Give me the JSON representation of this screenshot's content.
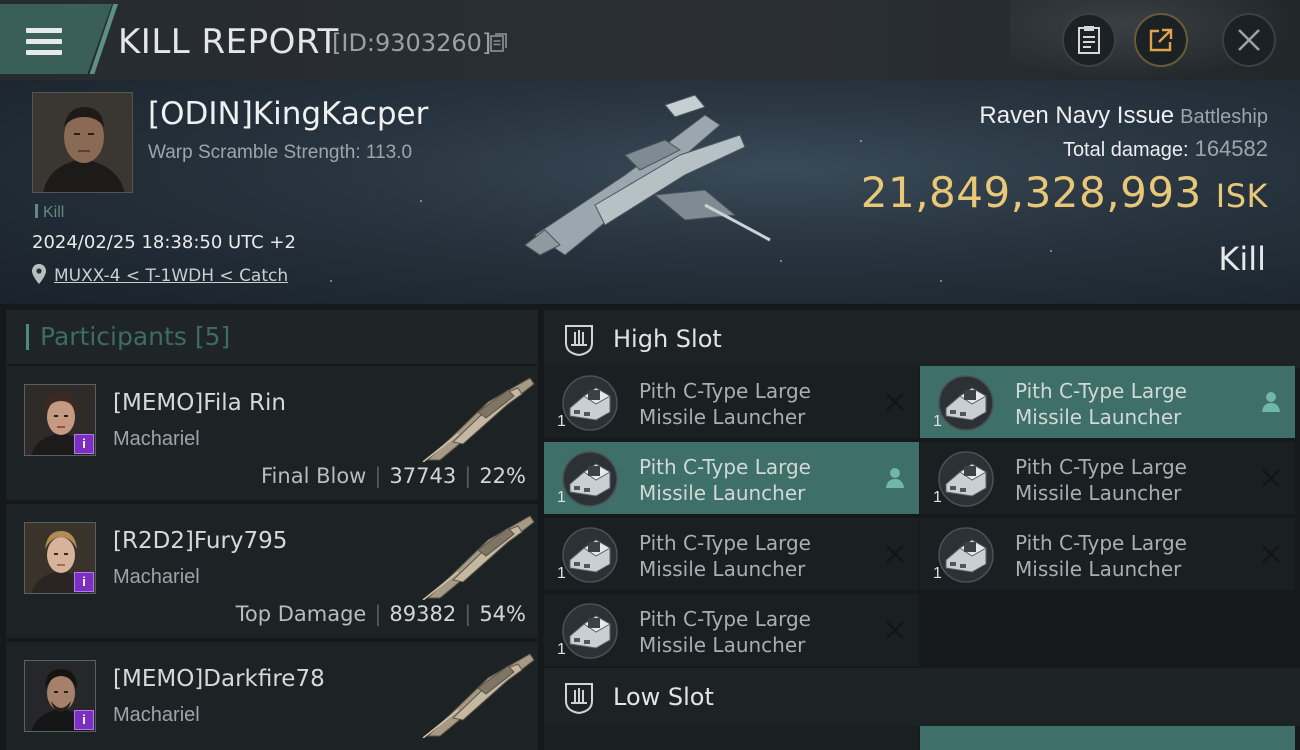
{
  "header": {
    "title": "KILL REPORT",
    "report_id": "[ID:9303260]"
  },
  "victim": {
    "name": "[ODIN]KingKacper",
    "warp_scramble": "Warp Scramble Strength: 113.0",
    "tag": "Kill",
    "datetime": "2024/02/25 18:38:50 UTC +2",
    "location": "MUXX-4 < T-1WDH < Catch",
    "ship": "Raven Navy Issue",
    "ship_class": "Battleship",
    "total_damage_label": "Total damage:",
    "total_damage": "164582",
    "isk_value": "21,849,328,993",
    "isk_unit": "ISK",
    "result": "Kill"
  },
  "participants": {
    "label": "Participants",
    "count": "[5]",
    "list": [
      {
        "name": "[MEMO]Fila Rin",
        "ship": "Machariel",
        "role": "Final Blow",
        "damage": "37743",
        "percent": "22%",
        "badge": "i"
      },
      {
        "name": "[R2D2]Fury795",
        "ship": "Machariel",
        "role": "Top Damage",
        "damage": "89382",
        "percent": "54%",
        "badge": "i"
      },
      {
        "name": "[MEMO]Darkfire78",
        "ship": "Machariel",
        "role": "",
        "damage": "",
        "percent": "",
        "badge": "i"
      }
    ]
  },
  "slots": {
    "high_label": "High Slot",
    "low_label": "Low Slot",
    "high": [
      {
        "line1": "Pith C-Type Large",
        "line2": "Missile Launcher",
        "qty": "1",
        "state": "destroyed"
      },
      {
        "line1": "Pith C-Type Large",
        "line2": "Missile Launcher",
        "qty": "1",
        "state": "dropped"
      },
      {
        "line1": "Pith C-Type Large",
        "line2": "Missile Launcher",
        "qty": "1",
        "state": "dropped"
      },
      {
        "line1": "Pith C-Type Large",
        "line2": "Missile Launcher",
        "qty": "1",
        "state": "destroyed"
      },
      {
        "line1": "Pith C-Type Large",
        "line2": "Missile Launcher",
        "qty": "1",
        "state": "destroyed"
      },
      {
        "line1": "Pith C-Type Large",
        "line2": "Missile Launcher",
        "qty": "1",
        "state": "destroyed"
      },
      {
        "line1": "Pith C-Type Large",
        "line2": "Missile Launcher",
        "qty": "1",
        "state": "destroyed"
      }
    ]
  },
  "icons": {
    "menu": "hamburger-icon",
    "copy": "copy-icon",
    "report": "clipboard-icon",
    "share": "share-icon",
    "close": "close-icon",
    "location": "location-pin-icon",
    "destroyed": "x-icon",
    "dropped": "person-icon"
  },
  "colors": {
    "accent": "#4f8a7f",
    "isk": "#e8c777",
    "active_row": "#3f6f69"
  }
}
